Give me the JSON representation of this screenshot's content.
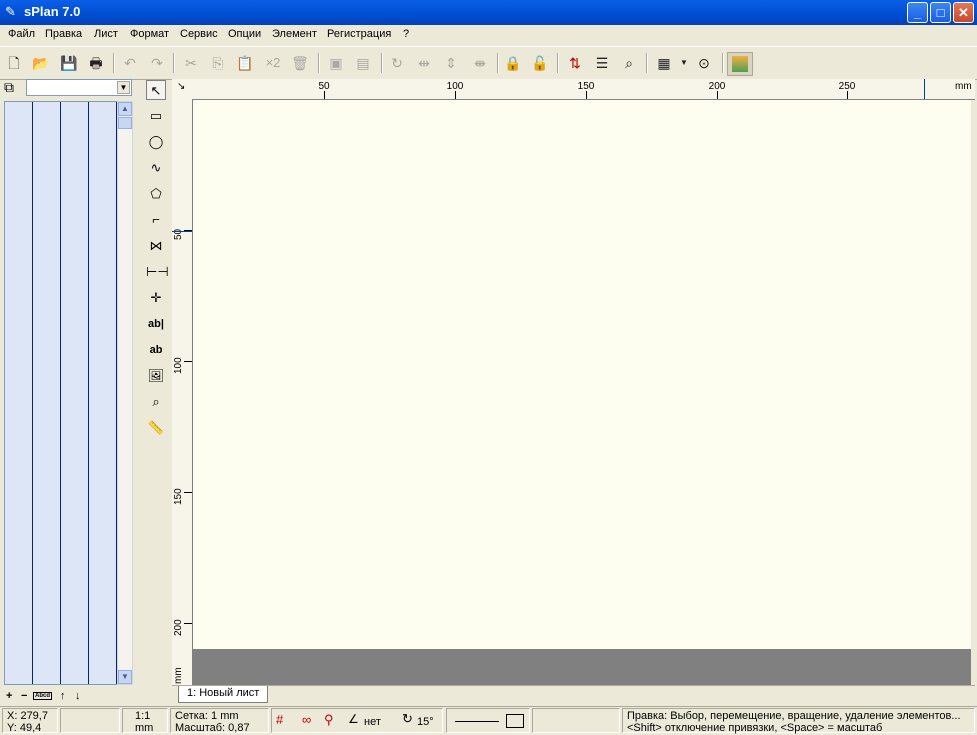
{
  "window": {
    "title": "sPlan 7.0",
    "minimize": "_",
    "maximize": "□",
    "close": "✕"
  },
  "menu": [
    "Файл",
    "Правка",
    "Лист",
    "Формат",
    "Сервис",
    "Опции",
    "Элемент",
    "Регистрация",
    "?"
  ],
  "toolbar": {
    "multiply_label": "×2",
    "icons": [
      "new-file-icon",
      "open-folder-icon",
      "save-icon",
      "print-icon",
      "undo-icon",
      "redo-icon",
      "cut-icon",
      "copy-icon",
      "paste-icon",
      "duplicate-icon",
      "delete-icon",
      "group-icon",
      "ungroup-icon",
      "rotate-icon",
      "mirror-horizontal-icon",
      "mirror-vertical-icon",
      "mirror-both-icon",
      "lock-icon",
      "unlock-icon",
      "numbering-icon",
      "list-icon",
      "search-binoculars-icon",
      "grid-icon",
      "zoom-fit-icon",
      "layer-view-icon"
    ]
  },
  "ruler": {
    "h_labels": [
      "50",
      "100",
      "150",
      "200",
      "250"
    ],
    "h_unit": "mm",
    "v_labels": [
      "50",
      "100",
      "150",
      "200"
    ],
    "v_unit": "mm"
  },
  "sheet_tab": "1: Новый лист",
  "layer_buttons": {
    "add": "+",
    "remove": "−",
    "abc": "Abcd",
    "up": "↑",
    "down": "↓"
  },
  "status": {
    "x": "X: 279,7",
    "y": "Y: 49,4",
    "scale_ratio": "1:1",
    "unit": "mm",
    "grid": "Сетка: 1 mm",
    "zoom": "Масштаб:  0,87",
    "snap_none": "нет",
    "angle": "15°",
    "hint1": "Правка: Выбор, перемещение, вращение, удаление элементов...",
    "hint2": "<Shift> отключение привязки, <Space> = масштаб"
  }
}
